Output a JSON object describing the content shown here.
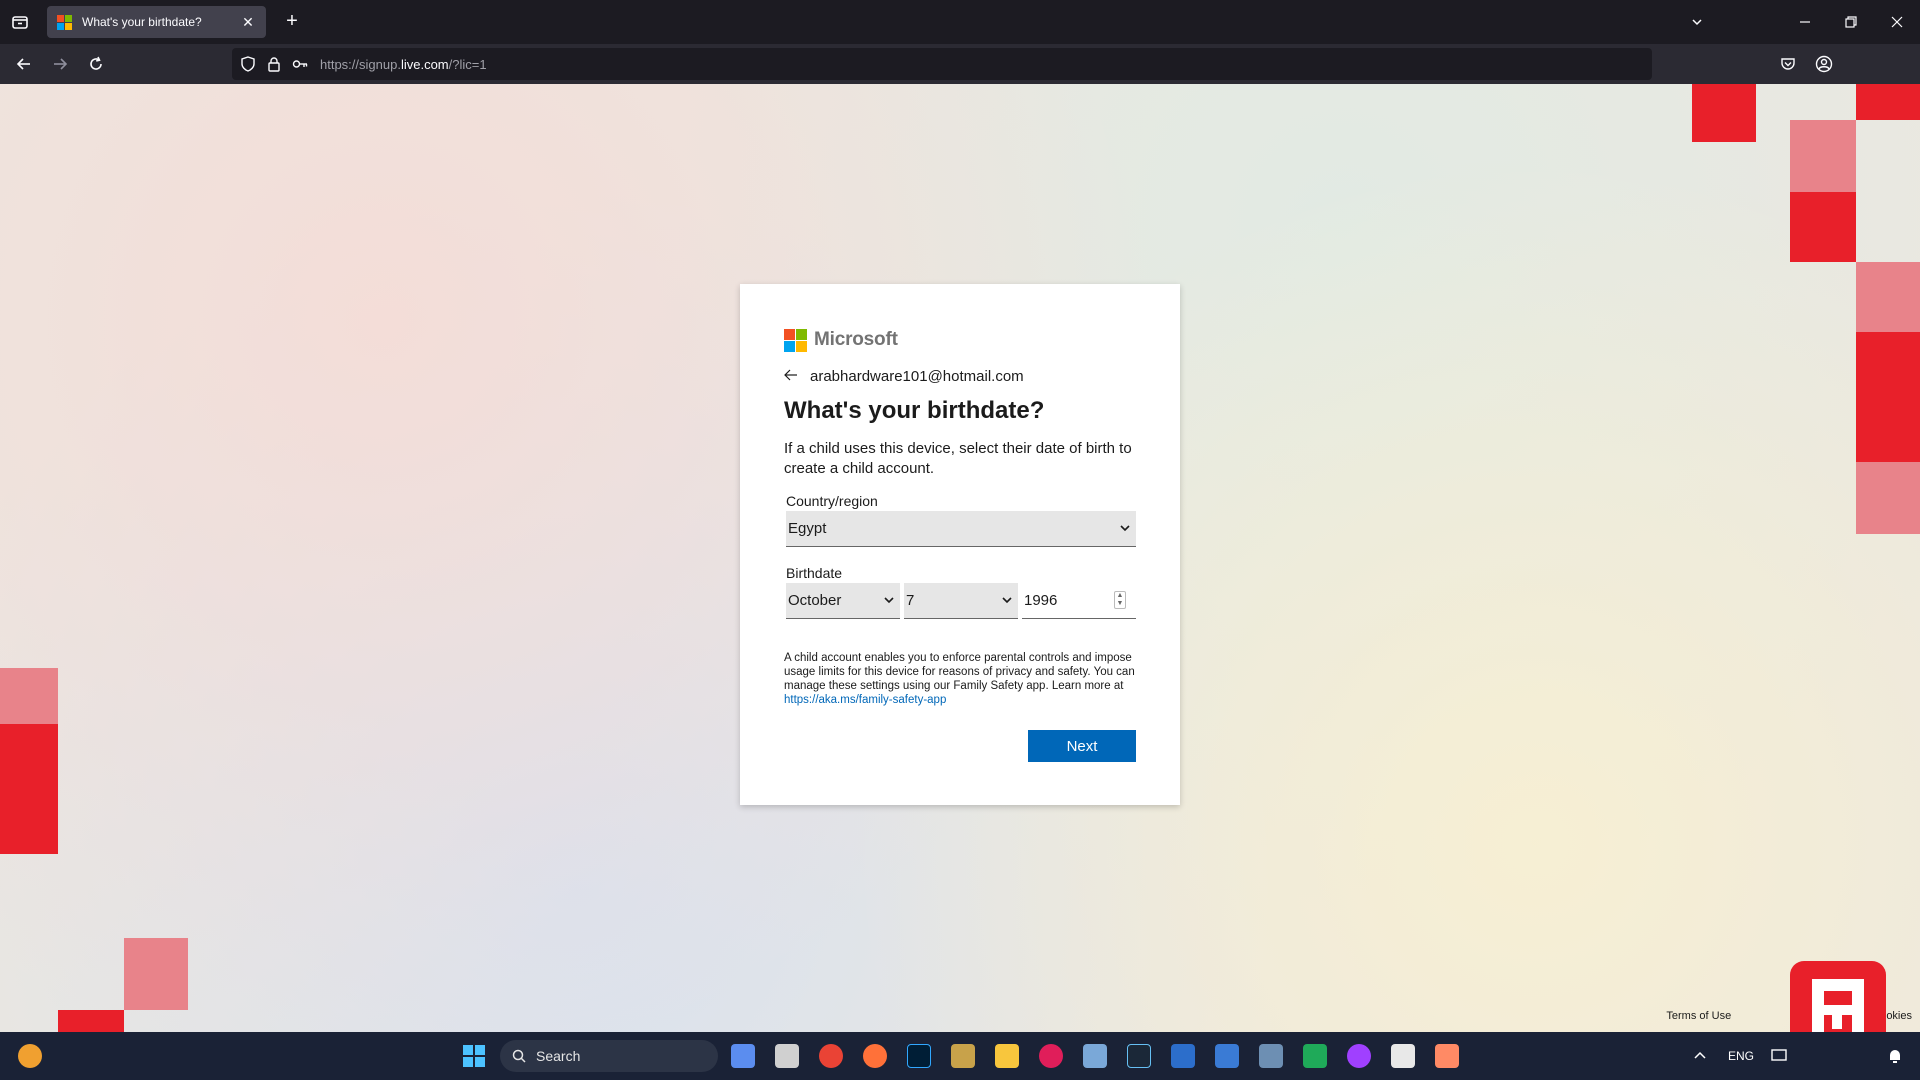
{
  "browser": {
    "tab_title": "What's your birthdate?",
    "url_prefix": "https://signup.",
    "url_domain": "live.com",
    "url_path": "/?lic=1"
  },
  "card": {
    "brand": "Microsoft",
    "email": "arabhardware101@hotmail.com",
    "title": "What's your birthdate?",
    "description": "If a child uses this device, select their date of birth to create a child account.",
    "country_label": "Country/region",
    "country_value": "Egypt",
    "birthdate_label": "Birthdate",
    "month_value": "October",
    "day_value": "7",
    "year_value": "1996",
    "info_text": "A child account enables you to enforce parental controls and impose usage limits for this device for reasons of privacy and safety. You can manage these settings using our Family Safety app. Learn more at ",
    "info_link": "https://aka.ms/family-safety-app",
    "next_label": "Next"
  },
  "footer": {
    "terms": "Terms of Use",
    "privacy": "Privacy & cookies"
  },
  "taskbar": {
    "search_label": "Search",
    "language": "ENG"
  },
  "colors": {
    "accent": "#0067b8",
    "ms_red": "#f25022",
    "ms_green": "#7fba00",
    "ms_blue": "#00a4ef",
    "ms_yellow": "#ffb900",
    "overlay_red": "#e8202a"
  }
}
